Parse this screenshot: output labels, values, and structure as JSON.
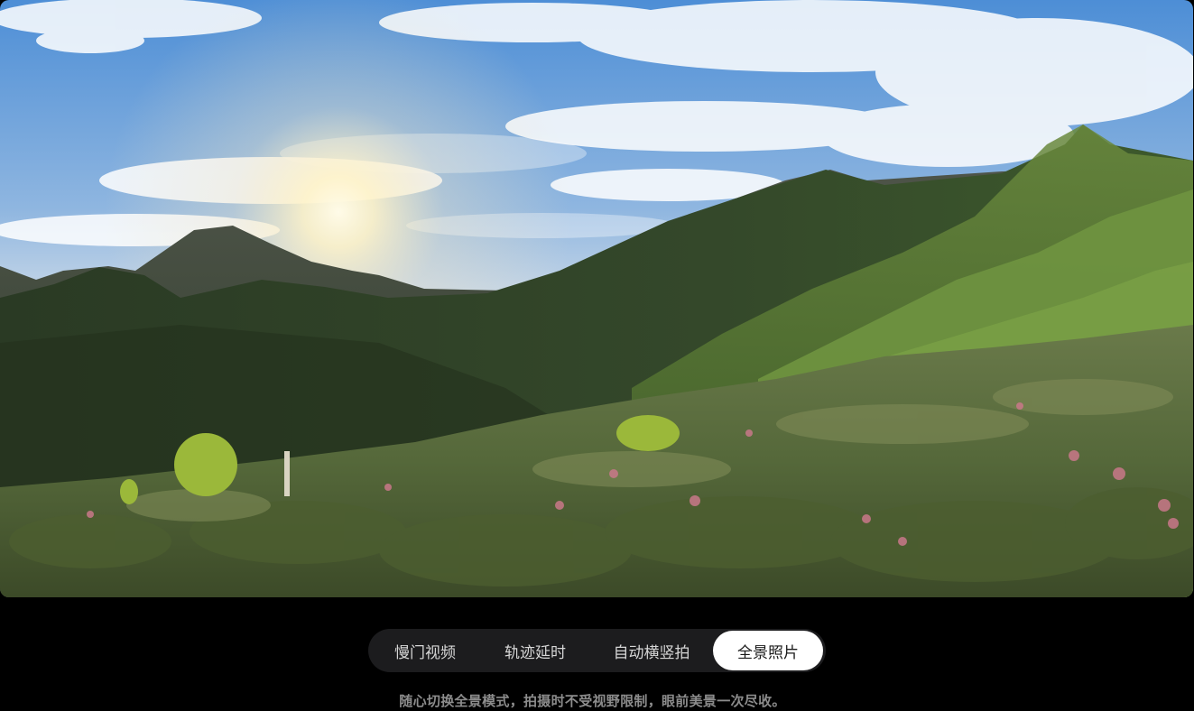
{
  "photo": {
    "subject": "mountain-landscape-panorama"
  },
  "mode_tabs": [
    {
      "label": "慢门视频",
      "active": false
    },
    {
      "label": "轨迹延时",
      "active": false
    },
    {
      "label": "自动横竖拍",
      "active": false
    },
    {
      "label": "全景照片",
      "active": true
    }
  ],
  "caption": "随心切换全景模式，拍摄时不受视野限制，眼前美景一次尽收。",
  "colors": {
    "background": "#000000",
    "tab_bar": "#1c1c1e",
    "tab_active": "#ffffff",
    "caption": "#8c8c8c"
  }
}
